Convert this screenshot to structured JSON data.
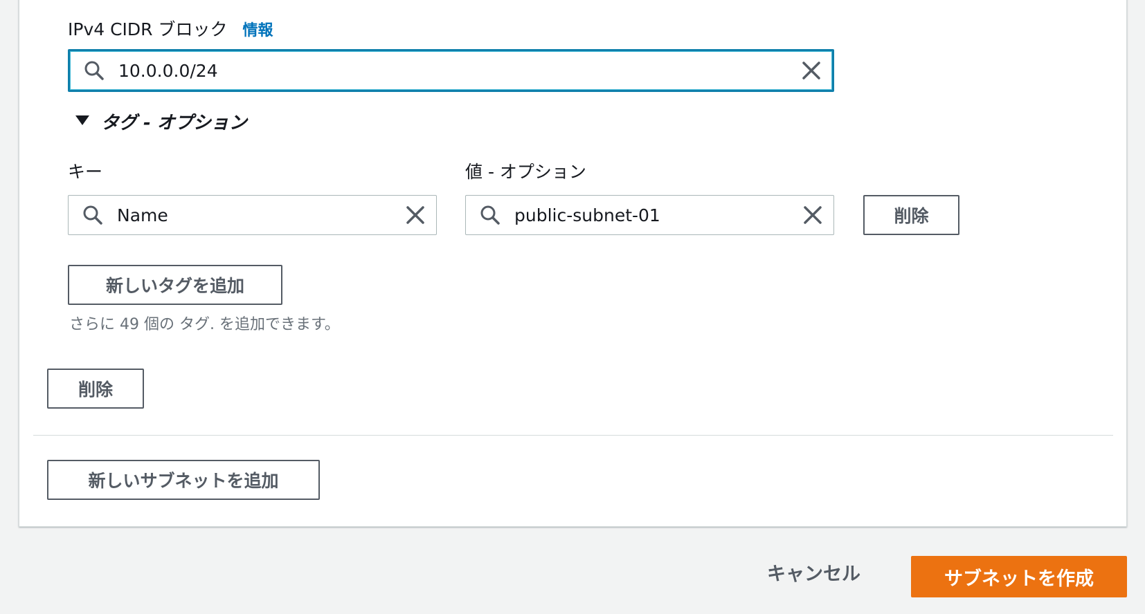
{
  "cidr": {
    "label": "IPv4 CIDR ブロック",
    "info": "情報",
    "value": "10.0.0.0/24"
  },
  "tags": {
    "section_title": "タグ - オプション",
    "key_label": "キー",
    "value_label": "値 - オプション",
    "key_value": "Name",
    "value_value": "public-subnet-01",
    "remove_tag_label": "削除",
    "add_tag_label": "新しいタグを追加",
    "hint": "さらに 49 個の タグ. を追加できます。"
  },
  "subnet": {
    "remove_label": "削除",
    "add_subnet_label": "新しいサブネットを追加"
  },
  "footer": {
    "cancel_label": "キャンセル",
    "create_label": "サブネットを作成"
  },
  "colors": {
    "primary": "#ec7211",
    "focus": "#0f7fab",
    "link": "#0073bb"
  },
  "icons": [
    "search-icon",
    "close-icon",
    "caret-down-icon"
  ]
}
